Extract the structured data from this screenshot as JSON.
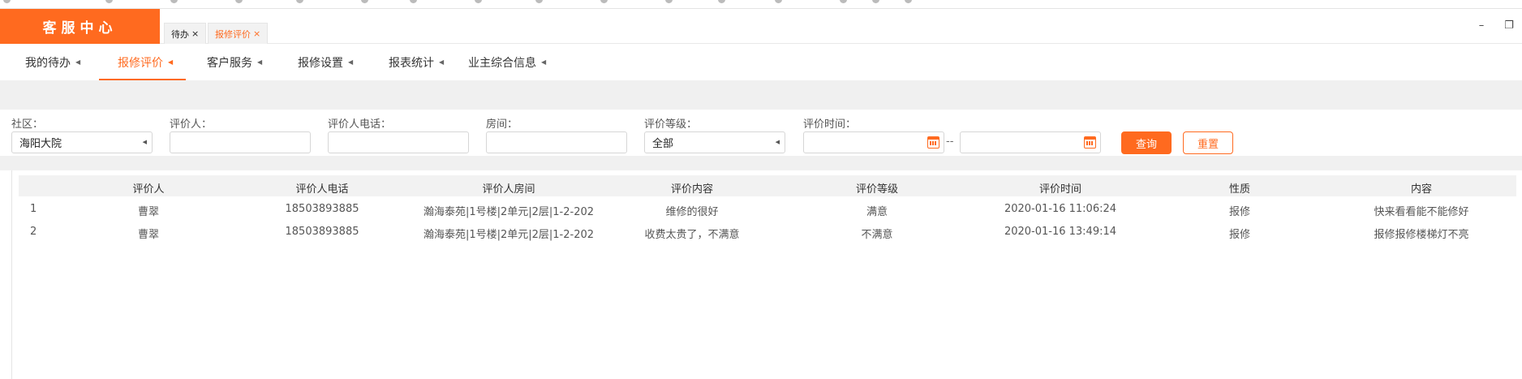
{
  "brand": {
    "title": "客服中心"
  },
  "page_tabs": [
    {
      "label": "待办",
      "close": "×",
      "active": false
    },
    {
      "label": "报修评价",
      "close": "×",
      "active": true
    }
  ],
  "window_controls": {
    "minimize": "–",
    "restore": "❐"
  },
  "nav": [
    {
      "label": "我的待办",
      "active": false
    },
    {
      "label": "报修评价",
      "active": true
    },
    {
      "label": "客户服务",
      "active": false
    },
    {
      "label": "报修设置",
      "active": false
    },
    {
      "label": "报表统计",
      "active": false
    },
    {
      "label": "业主综合信息",
      "active": false
    }
  ],
  "filters": {
    "community": {
      "label": "社区：",
      "value": "海阳大院"
    },
    "rater": {
      "label": "评价人：",
      "value": ""
    },
    "rater_phone": {
      "label": "评价人电话：",
      "value": ""
    },
    "room": {
      "label": "房间：",
      "value": ""
    },
    "rating_level": {
      "label": "评价等级：",
      "value": "全部"
    },
    "rating_time": {
      "label": "评价时间：",
      "from": "",
      "to": "",
      "separator": "--"
    }
  },
  "buttons": {
    "query": "查询",
    "reset": "重置"
  },
  "table": {
    "columns": [
      "评价人",
      "评价人电话",
      "评价人房间",
      "评价内容",
      "评价等级",
      "评价时间",
      "性质",
      "内容"
    ],
    "rows": [
      [
        "1",
        "曹翠",
        "18503893885",
        "瀚海泰苑|1号楼|2单元|2层|1-2-202",
        "维修的很好",
        "满意",
        "2020-01-16 11:06:24",
        "报修",
        "快来看看能不能修好"
      ],
      [
        "2",
        "曹翠",
        "18503893885",
        "瀚海泰苑|1号楼|2单元|2层|1-2-202",
        "收费太贵了，不满意",
        "不满意",
        "2020-01-16 13:49:14",
        "报修",
        "报修报修楼梯灯不亮"
      ]
    ]
  },
  "colors": {
    "accent": "#ff6a1f"
  }
}
